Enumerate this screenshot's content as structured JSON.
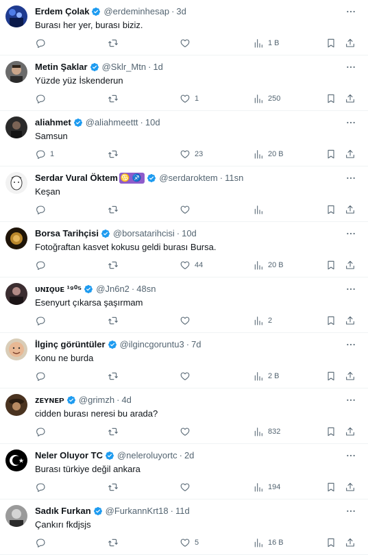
{
  "tweets": [
    {
      "name": "Erdem Çolak",
      "handle": "@erdeminhesap",
      "time": "3d",
      "text": "Burası her yer, burası biziz.",
      "replies": "",
      "retweets": "",
      "likes": "",
      "views": "1 B",
      "avatar": "avatar-blue-concert",
      "emoji": ""
    },
    {
      "name": "Metin Şaklar",
      "handle": "@Sklr_Mtn",
      "time": "1d",
      "text": "Yüzde yüz İskenderun",
      "replies": "",
      "retweets": "",
      "likes": "1",
      "views": "250",
      "avatar": "avatar-man-portrait",
      "emoji": ""
    },
    {
      "name": "aliahmet",
      "handle": "@aliahmeettt",
      "time": "10d",
      "text": "Samsun",
      "replies": "1",
      "retweets": "",
      "likes": "23",
      "views": "20 B",
      "avatar": "avatar-dark-figure",
      "emoji": ""
    },
    {
      "name": "Serdar Vural Öktem",
      "handle": "@serdaroktem",
      "time": "11sn",
      "text": "Keşan",
      "replies": "",
      "retweets": "",
      "likes": "",
      "views": "",
      "avatar": "avatar-sketch-face",
      "emoji": "♋♐"
    },
    {
      "name": "Borsa Tarihçisi",
      "handle": "@borsatarihcisi",
      "time": "10d",
      "text": "Fotoğraftan kasvet kokusu geldi burası Bursa.",
      "replies": "",
      "retweets": "",
      "likes": "44",
      "views": "20 B",
      "avatar": "avatar-gold-emblem",
      "emoji": ""
    },
    {
      "name": "ᴜɴɪǫᴜᴇ ¹⁹⁰⁵",
      "handle": "@Jn6n2",
      "time": "48sn",
      "text": "Esenyurt çıkarsa şaşırmam",
      "replies": "",
      "retweets": "",
      "likes": "",
      "views": "2",
      "avatar": "avatar-dark-portrait",
      "emoji": ""
    },
    {
      "name": "İlginç görüntüler",
      "handle": "@ilgincgoruntu3",
      "time": "7d",
      "text": "Konu ne burda",
      "replies": "",
      "retweets": "",
      "likes": "",
      "views": "2 B",
      "avatar": "avatar-smiling-face",
      "emoji": ""
    },
    {
      "name": "ᴢᴇʏɴᴇᴘ",
      "handle": "@grimzh",
      "time": "4d",
      "text": "cidden burası neresi bu arada?",
      "replies": "",
      "retweets": "",
      "likes": "",
      "views": "832",
      "avatar": "avatar-brown-hat",
      "emoji": ""
    },
    {
      "name": "Neler Oluyor TC",
      "handle": "@neleroluyortc",
      "time": "2d",
      "text": "Burası türkiye değil ankara",
      "replies": "",
      "retweets": "",
      "likes": "",
      "views": "194",
      "avatar": "avatar-crescent-star",
      "emoji": ""
    },
    {
      "name": "Sadık Furkan",
      "handle": "@FurkannKrt18",
      "time": "11d",
      "text": "Çankırı fkdjsjs",
      "replies": "",
      "retweets": "",
      "likes": "5",
      "views": "16 B",
      "avatar": "avatar-man-bw",
      "emoji": ""
    }
  ],
  "colors": {
    "verified": "#1d9bf0",
    "secondary": "#536471",
    "divider": "#eff3f4"
  }
}
